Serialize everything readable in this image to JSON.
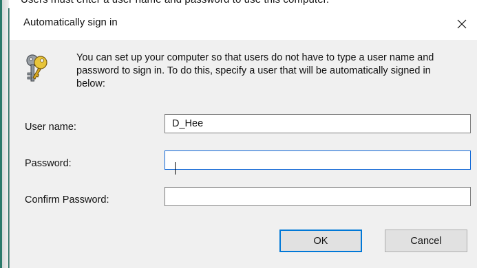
{
  "background": {
    "partial_text": "Users must enter a user name and password to use this computer."
  },
  "dialog": {
    "title": "Automatically sign in",
    "close_glyph": "×",
    "icon": "key-icon",
    "description": "You can set up your computer so that users do not have to type a user name and password to sign in. To do this, specify a user that will be automatically signed in below:",
    "fields": {
      "username": {
        "label": "User name:",
        "value": "D_Hee"
      },
      "password": {
        "label": "Password:",
        "value": ""
      },
      "confirm_password": {
        "label": "Confirm Password:",
        "value": ""
      }
    },
    "buttons": {
      "ok": "OK",
      "cancel": "Cancel"
    }
  },
  "colors": {
    "accent": "#0078d7",
    "focus_border": "#0a64d6",
    "dialog_bg": "#f0f0f0"
  }
}
